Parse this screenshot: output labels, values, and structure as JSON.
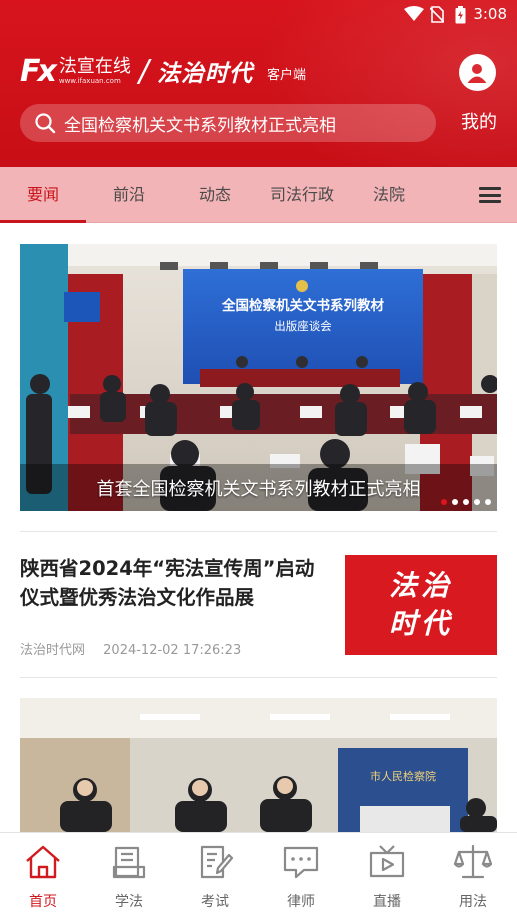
{
  "status_bar": {
    "time": "3:08"
  },
  "header": {
    "logo_mark": "Fx",
    "logo_cn": "法宣在线",
    "logo_url": "www.ifaxuan.com",
    "logo_brand": "法治时代",
    "logo_client": "客户端",
    "search_text": "全国检察机关文书系列教材正式亮相",
    "me_label": "我的"
  },
  "tabs": {
    "items": [
      "要闻",
      "前沿",
      "动态",
      "司法行政",
      "法院"
    ],
    "active": "要闻",
    "menu_icon": "menu-icon"
  },
  "banner": {
    "screen_line1": "全国检察机关文书系列教材",
    "screen_line2": "出版座谈会",
    "caption": "首套全国检察机关文书系列教材正式亮相",
    "slide_count": 5,
    "active_slide": 1
  },
  "news": {
    "title": "陕西省2024年“宪法宣传周”启动仪式暨优秀法治文化作品展",
    "source": "法治时代网",
    "time": "2024-12-02 17:26:23",
    "thumb_line1": "法治",
    "thumb_line2": "时代"
  },
  "photo2": {
    "sign_text": "市人民检察院"
  },
  "bottom_nav": {
    "items": [
      {
        "label": "首页",
        "icon": "home-icon"
      },
      {
        "label": "学法",
        "icon": "study-icon"
      },
      {
        "label": "考试",
        "icon": "exam-icon"
      },
      {
        "label": "律师",
        "icon": "lawyer-icon"
      },
      {
        "label": "直播",
        "icon": "live-icon"
      },
      {
        "label": "用法",
        "icon": "scale-icon"
      }
    ],
    "active": "首页"
  },
  "colors": {
    "brand_red": "#d7141d",
    "tab_bg": "#f3b4b7",
    "active_red": "#c8151d"
  }
}
